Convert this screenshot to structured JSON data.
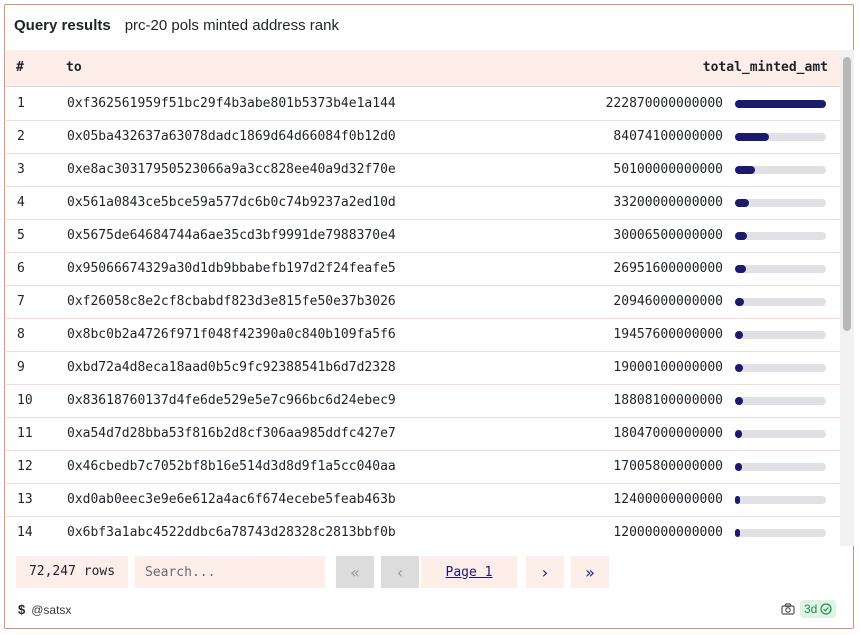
{
  "header": {
    "label": "Query results",
    "title": "prc-20 pols minted address rank"
  },
  "table": {
    "columns": {
      "num": "#",
      "to": "to",
      "amount": "total_minted_amt"
    },
    "bar_color": "#1c1a6b",
    "bar_track_color": "#e0e0e5",
    "rows": [
      {
        "num": "1",
        "to": "0xf362561959f51bc29f4b3abe801b5373b4e1a144",
        "amount": "222870000000000",
        "value": 222870000000000
      },
      {
        "num": "2",
        "to": "0x05ba432637a63078dadc1869d64d66084f0b12d0",
        "amount": "84074100000000",
        "value": 84074100000000
      },
      {
        "num": "3",
        "to": "0xe8ac30317950523066a9a3cc828ee40a9d32f70e",
        "amount": "50100000000000",
        "value": 50100000000000
      },
      {
        "num": "4",
        "to": "0x561a0843ce5bce59a577dc6b0c74b9237a2ed10d",
        "amount": "33200000000000",
        "value": 33200000000000
      },
      {
        "num": "5",
        "to": "0x5675de64684744a6ae35cd3bf9991de7988370e4",
        "amount": "30006500000000",
        "value": 30006500000000
      },
      {
        "num": "6",
        "to": "0x95066674329a30d1db9bbabefb197d2f24feafe5",
        "amount": "26951600000000",
        "value": 26951600000000
      },
      {
        "num": "7",
        "to": "0xf26058c8e2cf8cbabdf823d3e815fe50e37b3026",
        "amount": "20946000000000",
        "value": 20946000000000
      },
      {
        "num": "8",
        "to": "0x8bc0b2a4726f971f048f42390a0c840b109fa5f6",
        "amount": "19457600000000",
        "value": 19457600000000
      },
      {
        "num": "9",
        "to": "0xbd72a4d8eca18aad0b5c9fc92388541b6d7d2328",
        "amount": "19000100000000",
        "value": 19000100000000
      },
      {
        "num": "10",
        "to": "0x83618760137d4fe6de529e5e7c966bc6d24ebec9",
        "amount": "18808100000000",
        "value": 18808100000000
      },
      {
        "num": "11",
        "to": "0xa54d7d28bba53f816b2d8cf306aa985ddfc427e7",
        "amount": "18047000000000",
        "value": 18047000000000
      },
      {
        "num": "12",
        "to": "0x46cbedb7c7052bf8b16e514d3d8d9f1a5cc040aa",
        "amount": "17005800000000",
        "value": 17005800000000
      },
      {
        "num": "13",
        "to": "0xd0ab0eec3e9e6e612a4ac6f674ecebe5feab463b",
        "amount": "12400000000000",
        "value": 12400000000000
      },
      {
        "num": "14",
        "to": "0x6bf3a1abc4522ddbc6a78743d28328c2813bbf0b",
        "amount": "12000000000000",
        "value": 12000000000000
      }
    ]
  },
  "pagination": {
    "rows_count": "72,247 rows",
    "search_placeholder": "Search...",
    "first_icon": "double-chevron-left-icon",
    "prev_icon": "chevron-left-icon",
    "page_label": "Page 1",
    "next_icon": "chevron-right-icon",
    "last_icon": "double-chevron-right-icon"
  },
  "footer": {
    "author_icon": "dollar-icon",
    "author": "@satsx",
    "camera_icon": "camera-icon",
    "age": "3d",
    "status_icon": "check-circle-icon",
    "age_color": "#2b8a4d"
  }
}
